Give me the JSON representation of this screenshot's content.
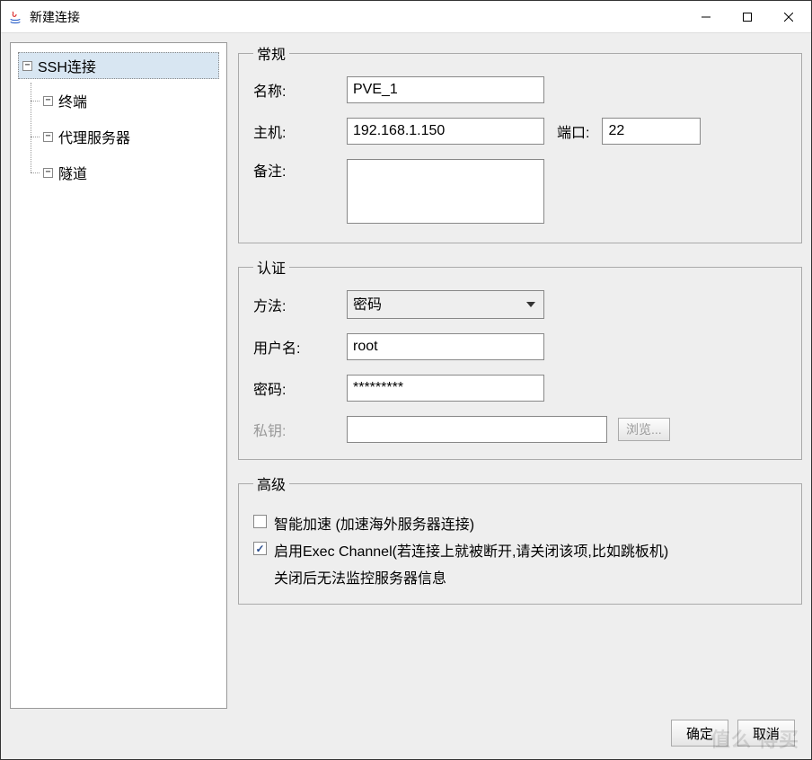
{
  "window": {
    "title": "新建连接"
  },
  "sidebar": {
    "root": "SSH连接",
    "items": [
      "终端",
      "代理服务器",
      "隧道"
    ]
  },
  "general": {
    "legend": "常规",
    "name_label": "名称:",
    "name_value": "PVE_1",
    "host_label": "主机:",
    "host_value": "192.168.1.150",
    "port_label": "端口:",
    "port_value": "22",
    "note_label": "备注:",
    "note_value": ""
  },
  "auth": {
    "legend": "认证",
    "method_label": "方法:",
    "method_value": "密码",
    "user_label": "用户名:",
    "user_value": "root",
    "pass_label": "密码:",
    "pass_value": "*********",
    "pk_label": "私钥:",
    "pk_value": "",
    "browse_label": "浏览..."
  },
  "advanced": {
    "legend": "高级",
    "smart_label": "智能加速 (加速海外服务器连接)",
    "smart_checked": false,
    "exec_label": "启用Exec Channel(若连接上就被断开,请关闭该项,比如跳板机)",
    "exec_checked": true,
    "exec_sub": "关闭后无法监控服务器信息"
  },
  "footer": {
    "ok": "确定",
    "cancel": "取消"
  },
  "watermark": "值么 得买"
}
